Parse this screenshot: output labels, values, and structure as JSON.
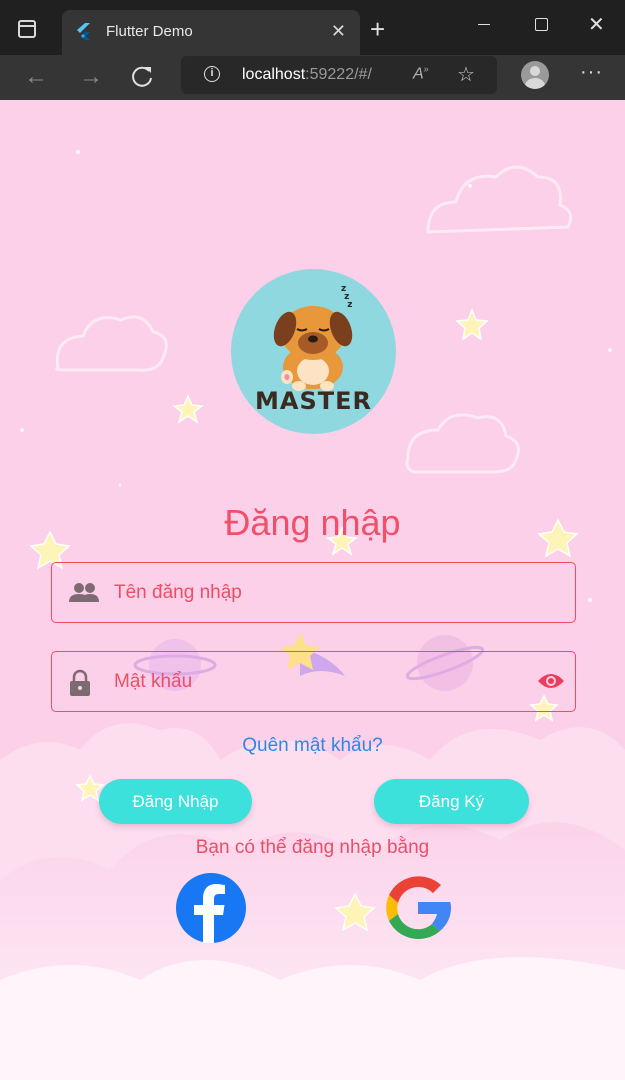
{
  "browser": {
    "tab_title": "Flutter Demo",
    "url_host": "localhost",
    "url_rest": ":59222/#/"
  },
  "login": {
    "brand": "MASTER",
    "title": "Đăng nhập",
    "username_placeholder": "Tên đăng nhập",
    "password_placeholder": "Mật khẩu",
    "forgot_link": "Quên mật khẩu?",
    "login_button": "Đăng Nhập",
    "register_button": "Đăng Ký",
    "alt_login_text": "Bạn có thể đăng nhập bằng",
    "social": [
      "facebook",
      "google"
    ]
  },
  "colors": {
    "background": "#fbd0e8",
    "accent": "#f0506a",
    "button": "#3be1da",
    "link": "#2f88e6",
    "avatar_bg": "#8fd8df"
  }
}
